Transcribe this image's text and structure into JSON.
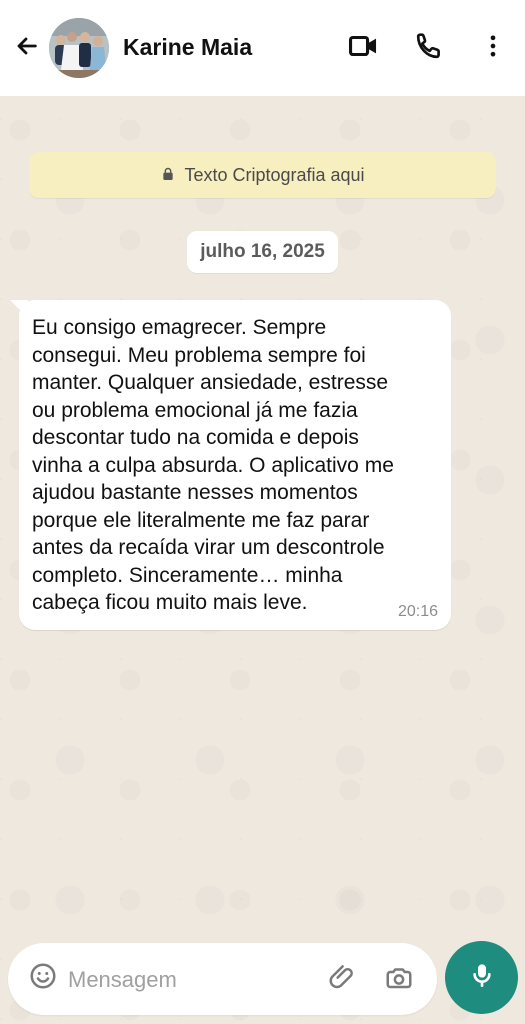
{
  "header": {
    "contact_name": "Karine Maia"
  },
  "encryption_banner": {
    "text": "Texto Criptografia aqui"
  },
  "chat": {
    "date_label": "julho 16, 2025",
    "message": {
      "text": "Eu consigo emagrecer. Sempre\nconsegui. Meu problema sempre foi\nmanter. Qualquer ansiedade, estresse\nou problema emocional já me fazia\ndescontar tudo na comida e depois\nvinha a culpa absurda. O aplicativo me\najudou bastante nesses momentos\nporque ele literalmente me faz parar\nantes da recaída virar um descontrole\ncompleto. Sinceramente… minha\ncabeça ficou muito mais leve.",
      "time": "20:16"
    }
  },
  "composer": {
    "placeholder": "Mensagem"
  },
  "icons": {
    "back": "arrow-left-icon",
    "video": "video-camera-icon",
    "phone": "phone-icon",
    "menu": "three-dot-menu-icon",
    "lock": "lock-icon",
    "emoji": "emoji-icon",
    "attach": "paperclip-icon",
    "camera": "camera-icon",
    "mic": "microphone-icon"
  },
  "colors": {
    "header_bg": "#ffffff",
    "chat_bg": "#efe8df",
    "encryption_bg": "#f8efc0",
    "bubble_bg": "#ffffff",
    "mic_bg": "#1e8c7f"
  }
}
